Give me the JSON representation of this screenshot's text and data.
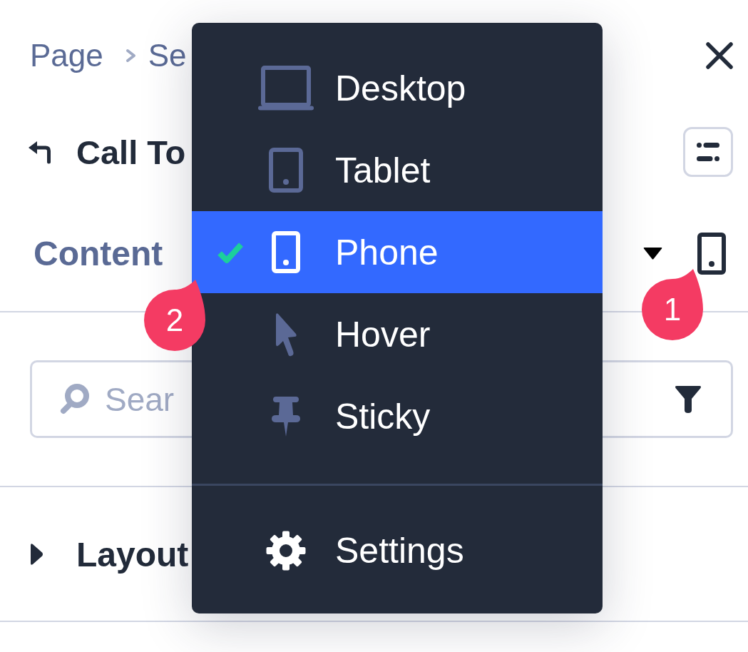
{
  "breadcrumb": [
    {
      "label": "Page"
    },
    {
      "label": "Se"
    }
  ],
  "header": {
    "title": "Call To"
  },
  "section": {
    "title": "Content"
  },
  "search": {
    "placeholder": "Sear"
  },
  "groups": [
    {
      "title": "Layout",
      "expanded": false
    }
  ],
  "device_menu": {
    "items": [
      {
        "label": "Desktop",
        "kind": "desktop",
        "selected": false
      },
      {
        "label": "Tablet",
        "kind": "tablet",
        "selected": false
      },
      {
        "label": "Phone",
        "kind": "phone",
        "selected": true
      },
      {
        "label": "Hover",
        "kind": "hover",
        "selected": false
      },
      {
        "label": "Sticky",
        "kind": "sticky",
        "selected": false
      }
    ],
    "actions": [
      {
        "label": "Settings",
        "kind": "settings"
      }
    ]
  },
  "callouts": [
    {
      "label": "1"
    },
    {
      "label": "2"
    }
  ]
}
